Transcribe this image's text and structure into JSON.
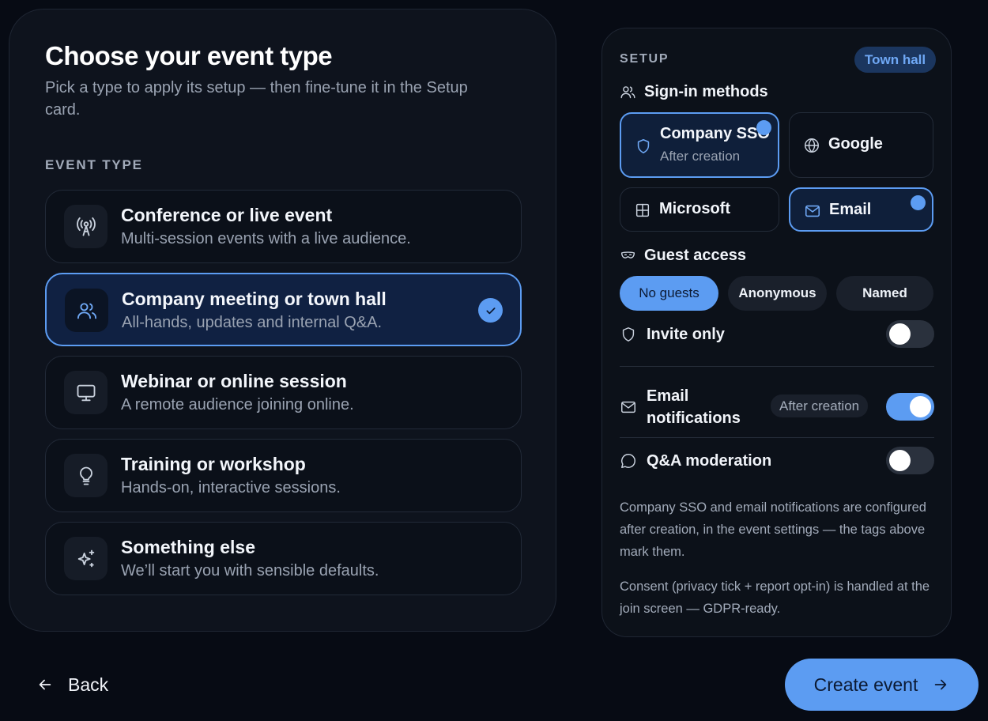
{
  "header": {
    "title": "Choose your event type",
    "subtitle": "Pick a type to apply its setup — then fine-tune it in the Setup card."
  },
  "event_type": {
    "label": "EVENT TYPE",
    "options": [
      {
        "title": "Conference or live event",
        "desc": "Multi-session events with a live audience.",
        "icon": "broadcast-icon",
        "selected": false
      },
      {
        "title": "Company meeting or town hall",
        "desc": "All-hands, updates and internal Q&A.",
        "icon": "users-icon",
        "selected": true
      },
      {
        "title": "Webinar or online session",
        "desc": "A remote audience joining online.",
        "icon": "monitor-icon",
        "selected": false
      },
      {
        "title": "Training or workshop",
        "desc": "Hands-on, interactive sessions.",
        "icon": "lightbulb-icon",
        "selected": false
      },
      {
        "title": "Something else",
        "desc": "We’ll start you with sensible defaults.",
        "icon": "sparkles-icon",
        "selected": false
      }
    ]
  },
  "setup": {
    "label": "SETUP",
    "badge": "Town hall",
    "signin": {
      "label": "Sign-in methods",
      "methods": [
        {
          "label": "Company SSO",
          "sub": "After creation",
          "icon": "shield-icon",
          "selected": true
        },
        {
          "label": "Google",
          "icon": "globe-icon",
          "selected": false
        },
        {
          "label": "Microsoft",
          "icon": "grid-icon",
          "selected": false
        },
        {
          "label": "Email",
          "icon": "mail-icon",
          "selected": true
        }
      ]
    },
    "guest": {
      "label": "Guest access",
      "options": [
        "No guests",
        "Anonymous",
        "Named"
      ],
      "selected": "No guests"
    },
    "toggles": {
      "invite_only": {
        "label": "Invite only",
        "on": false
      },
      "email_notifications": {
        "label": "Email notifications",
        "badge": "After creation",
        "on": true
      },
      "qa_moderation": {
        "label": "Q&A moderation",
        "on": false
      }
    },
    "notes": [
      "Company SSO and email notifications are configured after creation, in the event settings — the tags above mark them.",
      "Consent (privacy tick + report opt-in) is handled at the join screen — GDPR-ready."
    ]
  },
  "footer": {
    "back_label": "Back",
    "create_label": "Create event"
  },
  "colors": {
    "accent": "#5c9cf2",
    "background": "#070b14",
    "card": "#0e131d"
  }
}
